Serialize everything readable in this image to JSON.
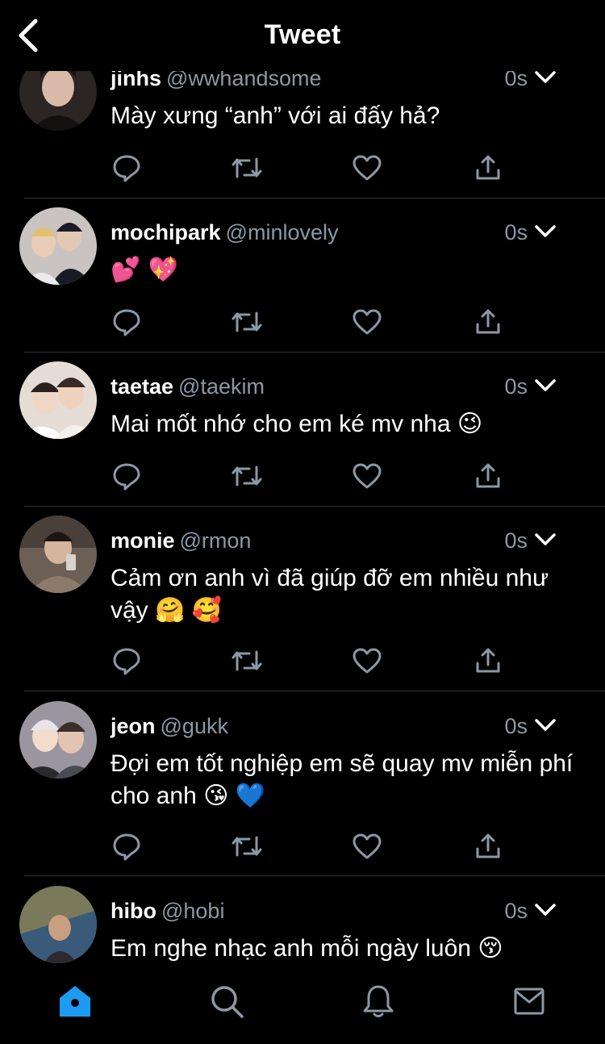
{
  "header": {
    "title": "Tweet"
  },
  "tweets": [
    {
      "name": "jinhs",
      "handle": "@wwhandsome",
      "time": "0s",
      "text": "Mày xưng “anh” với ai đấy hả?",
      "avatar_color": "#3a3330"
    },
    {
      "name": "mochipark",
      "handle": "@minlovely",
      "time": "0s",
      "text": "💕 💖",
      "avatar_color": "#bfb8b6"
    },
    {
      "name": "taetae",
      "handle": "@taekim",
      "time": "0s",
      "text": "Mai mốt nhớ cho em ké mv nha 😉",
      "avatar_color": "#d8c8c0"
    },
    {
      "name": "monie",
      "handle": "@rmon",
      "time": "0s",
      "text": "Cảm ơn anh vì đã giúp đỡ em nhiều như vậy 🤗 🥰",
      "avatar_color": "#5a5048"
    },
    {
      "name": "jeon",
      "handle": "@gukk",
      "time": "0s",
      "text": "Đợi em tốt nghiệp em sẽ quay mv miễn phí cho anh 😘 💙",
      "avatar_color": "#8a8690"
    },
    {
      "name": "hibo",
      "handle": "@hobi",
      "time": "0s",
      "text": "Em nghe nhạc anh mỗi ngày luôn 😚",
      "avatar_color": "#6a6a50"
    }
  ],
  "icons": {
    "back": "chevron-left-icon",
    "reply": "reply-icon",
    "retweet": "retweet-icon",
    "like": "heart-icon",
    "share": "share-icon",
    "caret": "chevron-down-icon",
    "tabs": [
      "home-icon",
      "search-icon",
      "notifications-icon",
      "messages-icon"
    ]
  },
  "colors": {
    "background": "#000000",
    "text": "#ffffff",
    "secondary_text": "#8b98a5",
    "active_tab": "#1d9bf0",
    "divider": "#2f3336"
  }
}
